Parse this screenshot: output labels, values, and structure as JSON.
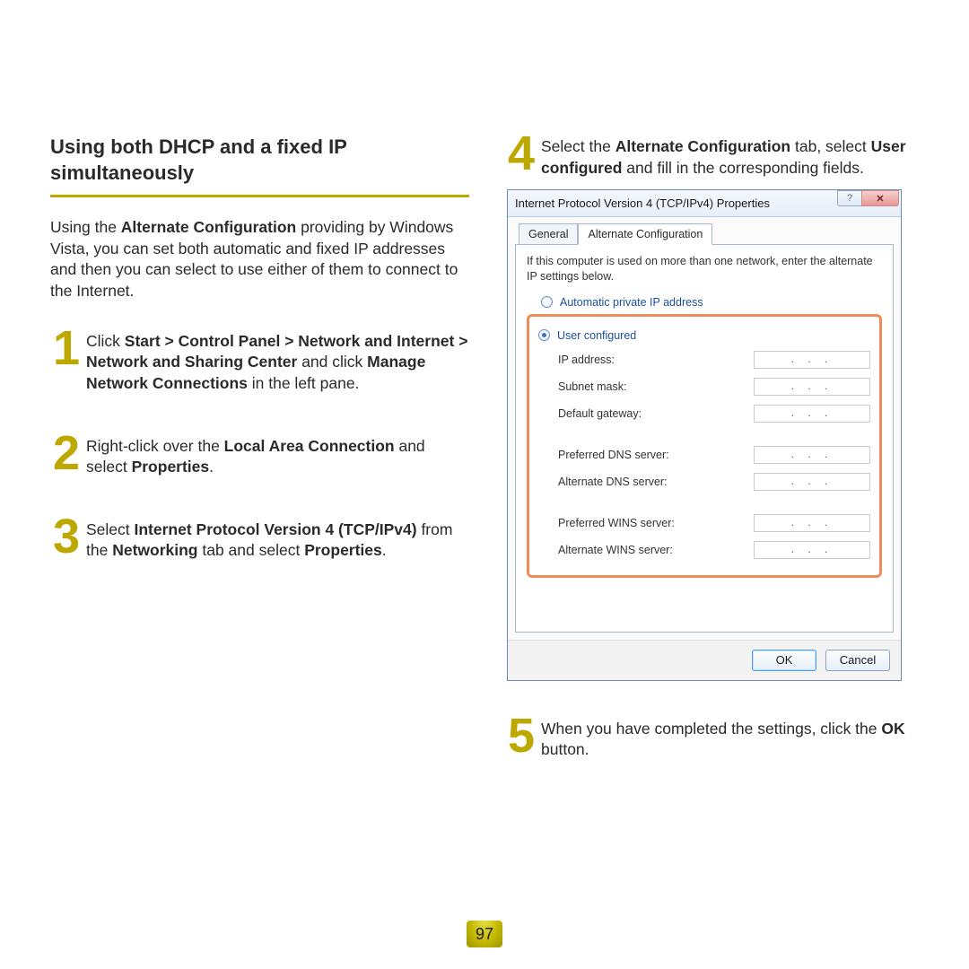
{
  "title": "Using both DHCP and a fixed IP simultaneously",
  "intro_parts": {
    "p1": "Using the ",
    "b1": "Alternate Configuration",
    "p2": " providing by Windows Vista, you can set both automatic and fixed IP addresses and then you can select to use either of them to connect to the Internet."
  },
  "steps": {
    "s1": {
      "num": "1",
      "t1": "Click ",
      "b1": "Start > Control Panel > Network and Internet > Network and Sharing Center",
      "t2": " and click ",
      "b2": "Manage Network Connections",
      "t3": " in the left pane."
    },
    "s2": {
      "num": "2",
      "t1": "Right-click over the ",
      "b1": "Local Area Connection",
      "t2": " and select ",
      "b2": "Properties",
      "t3": "."
    },
    "s3": {
      "num": "3",
      "t1": "Select ",
      "b1": "Internet Protocol Version 4 (TCP/IPv4)",
      "t2": " from the ",
      "b2": "Networking",
      "t3": " tab and select ",
      "b3": "Properties",
      "t4": "."
    },
    "s4": {
      "num": "4",
      "t1": "Select the ",
      "b1": "Alternate Configuration",
      "t2": " tab, select ",
      "b2": "User configured",
      "t3": " and fill in the corresponding fields."
    },
    "s5": {
      "num": "5",
      "t1": "When you have completed the settings, click the ",
      "b1": "OK",
      "t2": " button."
    }
  },
  "dialog": {
    "title": "Internet Protocol Version 4 (TCP/IPv4) Properties",
    "help_glyph": "?",
    "close_glyph": "✕",
    "tabs": {
      "general": "General",
      "alt": "Alternate Configuration"
    },
    "hint": "If this computer is used on more than one network, enter the alternate IP settings below.",
    "radio_auto": "Automatic private IP address",
    "radio_user": "User configured",
    "fields": {
      "ip": "IP address:",
      "subnet": "Subnet mask:",
      "gateway": "Default gateway:",
      "pdns": "Preferred DNS server:",
      "adns": "Alternate DNS server:",
      "pwins": "Preferred WINS server:",
      "awins": "Alternate WINS server:"
    },
    "ip_placeholder": ". . .",
    "ok": "OK",
    "cancel": "Cancel"
  },
  "page_number": "97"
}
